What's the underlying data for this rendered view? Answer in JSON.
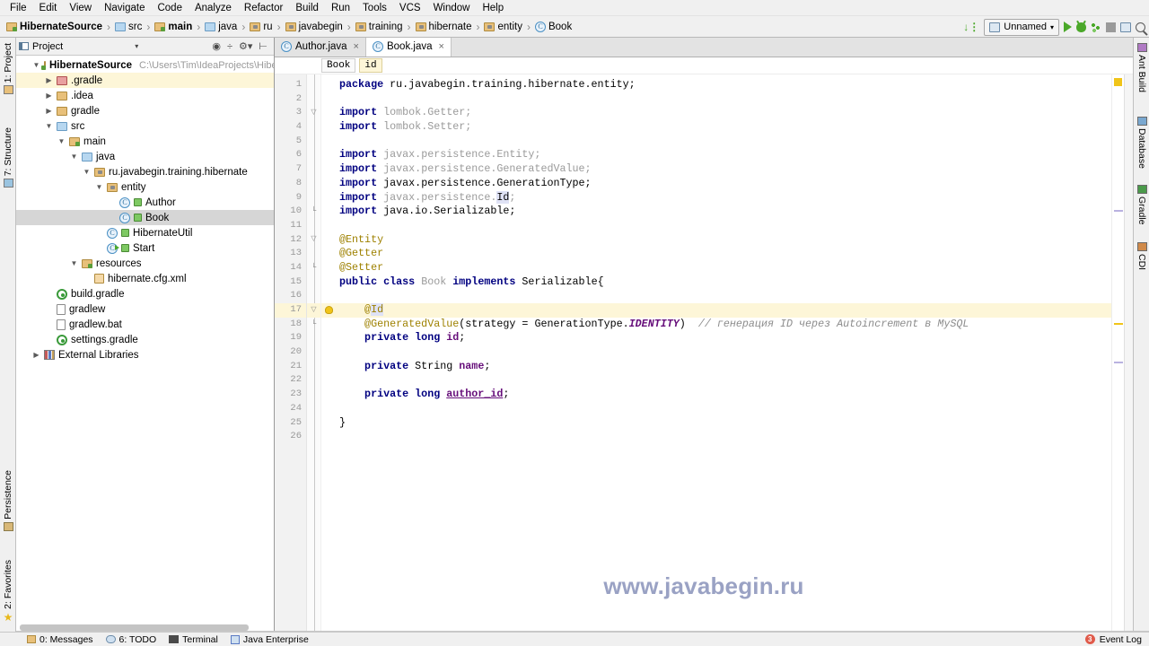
{
  "menu": {
    "items": [
      "File",
      "Edit",
      "View",
      "Navigate",
      "Code",
      "Analyze",
      "Refactor",
      "Build",
      "Run",
      "Tools",
      "VCS",
      "Window",
      "Help"
    ]
  },
  "navbar": {
    "breadcrumbs": [
      {
        "label": "HibernateSource",
        "icon": "folder-module-icon",
        "bold": true
      },
      {
        "label": "src",
        "icon": "folder-blue-icon",
        "bold": false
      },
      {
        "label": "main",
        "icon": "folder-source-icon",
        "bold": true
      },
      {
        "label": "java",
        "icon": "folder-blue-icon",
        "bold": false
      },
      {
        "label": "ru",
        "icon": "folder-package-icon",
        "bold": false
      },
      {
        "label": "javabegin",
        "icon": "folder-package-icon",
        "bold": false
      },
      {
        "label": "training",
        "icon": "folder-package-icon",
        "bold": false
      },
      {
        "label": "hibernate",
        "icon": "folder-package-icon",
        "bold": false
      },
      {
        "label": "entity",
        "icon": "folder-package-icon",
        "bold": false
      },
      {
        "label": "Book",
        "icon": "java-class-icon",
        "bold": false
      }
    ],
    "separator": "›",
    "run_config": "Unnamed",
    "run_config_chevron": "▾"
  },
  "left_strip": {
    "top": [
      {
        "label": "1: Project",
        "icon": "project-icon"
      },
      {
        "label": "7: Structure",
        "icon": "structure-icon"
      }
    ],
    "bottom": [
      {
        "label": "Persistence",
        "icon": "persistence-icon"
      },
      {
        "label": "2: Favorites",
        "icon": "star-icon"
      }
    ]
  },
  "right_strip": {
    "items": [
      {
        "label": "Ant Build",
        "icon": "ant-icon"
      },
      {
        "label": "Database",
        "icon": "database-icon"
      },
      {
        "label": "Gradle",
        "icon": "gradle-icon"
      },
      {
        "label": "CDI",
        "icon": "cdi-icon"
      }
    ]
  },
  "project_panel": {
    "title": "Project",
    "chevron": "▾",
    "tree": [
      {
        "label": "HibernateSource",
        "path": "C:\\Users\\Tim\\IdeaProjects\\Hibernat",
        "indent": 0,
        "arrow": "▼",
        "icon": "folder-module-icon",
        "bold": true,
        "state": "normal"
      },
      {
        "label": ".gradle",
        "indent": 1,
        "arrow": "▶",
        "icon": "folder-excluded-icon",
        "bold": false,
        "state": "highlight"
      },
      {
        "label": ".idea",
        "indent": 1,
        "arrow": "▶",
        "icon": "folder-icon",
        "bold": false,
        "state": "normal"
      },
      {
        "label": "gradle",
        "indent": 1,
        "arrow": "▶",
        "icon": "folder-icon",
        "bold": false,
        "state": "normal"
      },
      {
        "label": "src",
        "indent": 1,
        "arrow": "▼",
        "icon": "folder-blue-icon",
        "bold": false,
        "state": "normal"
      },
      {
        "label": "main",
        "indent": 2,
        "arrow": "▼",
        "icon": "folder-source-icon",
        "bold": false,
        "state": "normal"
      },
      {
        "label": "java",
        "indent": 3,
        "arrow": "▼",
        "icon": "folder-blue-icon",
        "bold": false,
        "state": "normal"
      },
      {
        "label": "ru.javabegin.training.hibernate",
        "indent": 4,
        "arrow": "▼",
        "icon": "folder-package-icon",
        "bold": false,
        "state": "normal"
      },
      {
        "label": "entity",
        "indent": 5,
        "arrow": "▼",
        "icon": "folder-package-icon",
        "bold": false,
        "state": "normal"
      },
      {
        "label": "Author",
        "indent": 6,
        "arrow": "",
        "icon": "java-class-icon",
        "bold": false,
        "state": "normal"
      },
      {
        "label": "Book",
        "indent": 6,
        "arrow": "",
        "icon": "java-class-icon",
        "bold": false,
        "state": "selected"
      },
      {
        "label": "HibernateUtil",
        "indent": 5,
        "arrow": "",
        "icon": "java-class-icon",
        "bold": false,
        "state": "normal"
      },
      {
        "label": "Start",
        "indent": 5,
        "arrow": "",
        "icon": "java-runnable-class-icon",
        "bold": false,
        "state": "normal"
      },
      {
        "label": "resources",
        "indent": 3,
        "arrow": "▼",
        "icon": "folder-resource-icon",
        "bold": false,
        "state": "normal"
      },
      {
        "label": "hibernate.cfg.xml",
        "indent": 4,
        "arrow": "",
        "icon": "xml-file-icon",
        "bold": false,
        "state": "normal"
      },
      {
        "label": "build.gradle",
        "indent": 1,
        "arrow": "",
        "icon": "gradle-file-icon",
        "bold": false,
        "state": "normal"
      },
      {
        "label": "gradlew",
        "indent": 1,
        "arrow": "",
        "icon": "file-icon",
        "bold": false,
        "state": "normal"
      },
      {
        "label": "gradlew.bat",
        "indent": 1,
        "arrow": "",
        "icon": "file-icon",
        "bold": false,
        "state": "normal"
      },
      {
        "label": "settings.gradle",
        "indent": 1,
        "arrow": "",
        "icon": "gradle-file-icon",
        "bold": false,
        "state": "normal"
      },
      {
        "label": "External Libraries",
        "indent": 0,
        "arrow": "▶",
        "icon": "libraries-icon",
        "bold": false,
        "state": "normal"
      }
    ]
  },
  "editor": {
    "tabs": [
      {
        "label": "Author.java",
        "active": false,
        "close": "×"
      },
      {
        "label": "Book.java",
        "active": true,
        "close": "×"
      }
    ],
    "breadcrumb": [
      {
        "label": "Book",
        "active": false
      },
      {
        "label": "id",
        "active": true
      }
    ],
    "first_line": 1,
    "last_line": 26,
    "highlight_line": 17,
    "lines": [
      {
        "n": 1,
        "tokens": [
          {
            "t": "package ",
            "c": "kw"
          },
          {
            "t": "ru.javabegin.training.hibernate.entity;",
            "c": "id"
          }
        ]
      },
      {
        "n": 2,
        "tokens": []
      },
      {
        "n": 3,
        "tokens": [
          {
            "t": "import ",
            "c": "kw"
          },
          {
            "t": "lombok.Getter;",
            "c": "grey"
          }
        ]
      },
      {
        "n": 4,
        "tokens": [
          {
            "t": "import ",
            "c": "kw"
          },
          {
            "t": "lombok.Setter;",
            "c": "grey"
          }
        ]
      },
      {
        "n": 5,
        "tokens": []
      },
      {
        "n": 6,
        "tokens": [
          {
            "t": "import ",
            "c": "kw"
          },
          {
            "t": "javax.persistence.Entity;",
            "c": "grey"
          }
        ]
      },
      {
        "n": 7,
        "tokens": [
          {
            "t": "import ",
            "c": "kw"
          },
          {
            "t": "javax.persistence.GeneratedValue;",
            "c": "grey"
          }
        ]
      },
      {
        "n": 8,
        "tokens": [
          {
            "t": "import ",
            "c": "kw"
          },
          {
            "t": "javax.persistence.GenerationType;",
            "c": "id"
          }
        ]
      },
      {
        "n": 9,
        "tokens": [
          {
            "t": "import ",
            "c": "kw"
          },
          {
            "t": "javax.persistence.",
            "c": "grey"
          },
          {
            "t": "Id",
            "c": "hlid"
          },
          {
            "t": ";",
            "c": "grey"
          }
        ]
      },
      {
        "n": 10,
        "tokens": [
          {
            "t": "import ",
            "c": "kw"
          },
          {
            "t": "java.io.Serializable;",
            "c": "id"
          }
        ]
      },
      {
        "n": 11,
        "tokens": []
      },
      {
        "n": 12,
        "tokens": [
          {
            "t": "@Entity",
            "c": "ann"
          }
        ]
      },
      {
        "n": 13,
        "tokens": [
          {
            "t": "@Getter",
            "c": "ann"
          }
        ]
      },
      {
        "n": 14,
        "tokens": [
          {
            "t": "@Setter",
            "c": "ann"
          }
        ]
      },
      {
        "n": 15,
        "tokens": [
          {
            "t": "public class ",
            "c": "kw"
          },
          {
            "t": "Book",
            "c": "grey"
          },
          {
            "t": " implements ",
            "c": "kw"
          },
          {
            "t": "Serializable{",
            "c": "id"
          }
        ]
      },
      {
        "n": 16,
        "tokens": []
      },
      {
        "n": 17,
        "tokens": [
          {
            "t": "    @",
            "c": "ann"
          },
          {
            "t": "Id",
            "c": "annhl"
          }
        ]
      },
      {
        "n": 18,
        "tokens": [
          {
            "t": "    @GeneratedValue",
            "c": "ann"
          },
          {
            "t": "(",
            "c": "id"
          },
          {
            "t": "strategy",
            "c": "id"
          },
          {
            "t": " = ",
            "c": "id"
          },
          {
            "t": "GenerationType.",
            "c": "id"
          },
          {
            "t": "IDENTITY",
            "c": "cst"
          },
          {
            "t": ")  ",
            "c": "id"
          },
          {
            "t": "// генерация ID через Autoincrement в MySQL",
            "c": "cmt"
          }
        ]
      },
      {
        "n": 19,
        "tokens": [
          {
            "t": "    private long ",
            "c": "kw"
          },
          {
            "t": "id",
            "c": "fld"
          },
          {
            "t": ";",
            "c": "id"
          }
        ]
      },
      {
        "n": 20,
        "tokens": []
      },
      {
        "n": 21,
        "tokens": [
          {
            "t": "    private ",
            "c": "kw"
          },
          {
            "t": "String ",
            "c": "id"
          },
          {
            "t": "name",
            "c": "fld"
          },
          {
            "t": ";",
            "c": "id"
          }
        ]
      },
      {
        "n": 22,
        "tokens": []
      },
      {
        "n": 23,
        "tokens": [
          {
            "t": "    private long ",
            "c": "kw"
          },
          {
            "t": "author_id",
            "c": "fldu"
          },
          {
            "t": ";",
            "c": "id"
          }
        ]
      },
      {
        "n": 24,
        "tokens": []
      },
      {
        "n": 25,
        "tokens": [
          {
            "t": "}",
            "c": "id"
          }
        ]
      },
      {
        "n": 26,
        "tokens": []
      }
    ],
    "fold_lines": [
      3,
      10,
      12,
      14,
      17,
      18
    ],
    "watermark": "www.javabegin.ru"
  },
  "status_bar": {
    "items": [
      {
        "label": "0: Messages",
        "icon": "messages-icon"
      },
      {
        "label": "6: TODO",
        "icon": "todo-icon"
      },
      {
        "label": "Terminal",
        "icon": "terminal-icon"
      },
      {
        "label": "Java Enterprise",
        "icon": "java-enterprise-icon"
      }
    ],
    "event_log": {
      "label": "Event Log",
      "count": "3"
    }
  },
  "colors": {
    "accent_green": "#4aa829",
    "warning_yellow": "#f0c419",
    "highlight_row": "#fdf6d8",
    "watermark": "#9aa2c4",
    "badge_red": "#e05a4a"
  }
}
